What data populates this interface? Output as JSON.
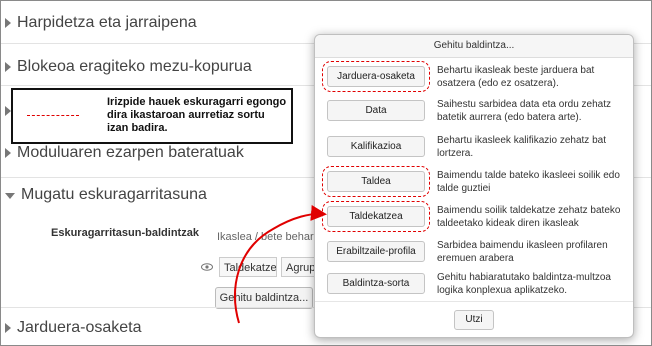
{
  "sections": {
    "harpidetza": "Harpidetza eta jarraipena",
    "blokeoa": "Blokeoa eragiteko mezu-kopurua",
    "moduluaren": "Moduluaren ezarpen bateratuak",
    "mugatu": "Mugatu eskuragarritasuna",
    "jarduera": "Jarduera-osaketa"
  },
  "callout": {
    "text": "Irizpide hauek eskuragarri egongo dira ikastaroan aurretiaz sortu izan badira."
  },
  "restriction": {
    "label": "Eskuragarritasun-baldintzak",
    "truncated_text": "Ikaslea  / bete behar d",
    "select1": "Taldekatzea",
    "select2": "Agrupa",
    "add_button": "Gehitu baldintza..."
  },
  "modal": {
    "title": "Gehitu baldintza...",
    "rows": [
      {
        "button": "Jarduera-osaketa",
        "description": "Behartu ikasleak beste jarduera bat osatzera (edo ez osatzera)."
      },
      {
        "button": "Data",
        "description": "Saihestu sarbidea data eta ordu zehatz batetik aurrera (edo batera arte)."
      },
      {
        "button": "Kalifikazioa",
        "description": "Behartu ikasleek kalifikazio zehatz bat lortzera."
      },
      {
        "button": "Taldea",
        "description": "Baimendu talde bateko ikasleei soilik edo talde guztiei"
      },
      {
        "button": "Taldekatzea",
        "description": "Baimendu soilik taldekatze zehatz bateko taldeetako kideak diren ikasleak"
      },
      {
        "button": "Erabiltzaile-profila",
        "description": "Sarbidea baimendu ikasleen profilaren eremuen arabera"
      },
      {
        "button": "Baldintza-sorta",
        "description": "Gehitu habiaratutako baldintza-multzoa logika konplexua aplikatzeko."
      }
    ],
    "cancel": "Utzi"
  },
  "colors": {
    "highlight": "#e00000",
    "arrow": "#e00000"
  }
}
